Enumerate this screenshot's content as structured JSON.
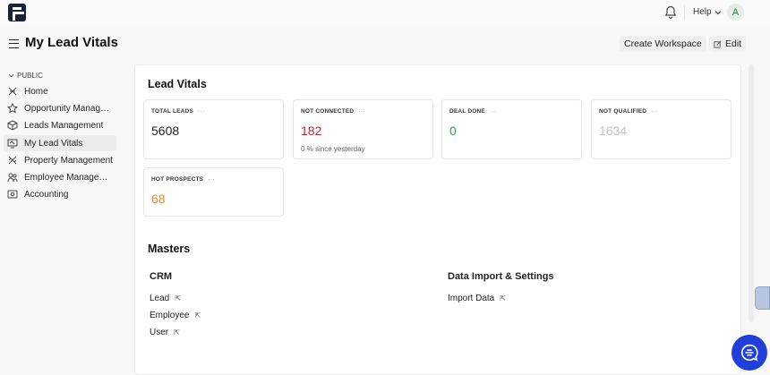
{
  "topbar": {
    "logo_icon": "app-logo",
    "bell_icon": "bell-icon",
    "help_label": "Help",
    "avatar_letter": "A"
  },
  "header": {
    "title": "My Lead Vitals",
    "create_workspace": "Create Workspace",
    "edit": "Edit"
  },
  "sidebar": {
    "section": "PUBLIC",
    "items": [
      {
        "label": "Home",
        "icon": "home-icon"
      },
      {
        "label": "Opportunity Management",
        "icon": "star-icon"
      },
      {
        "label": "Leads Management",
        "icon": "box-icon"
      },
      {
        "label": "My Lead Vitals",
        "icon": "monitor-icon",
        "active": true
      },
      {
        "label": "Property Management",
        "icon": "tools-icon"
      },
      {
        "label": "Employee Management",
        "icon": "users-icon"
      },
      {
        "label": "Accounting",
        "icon": "accounting-icon"
      }
    ]
  },
  "lead_vitals": {
    "title": "Lead Vitals",
    "cards": [
      {
        "label": "TOTAL LEADS",
        "value": "5608",
        "color": "#222222",
        "sub": ""
      },
      {
        "label": "NOT CONNECTED",
        "value": "182",
        "color": "#b82b35",
        "sub": "0 % since yesterday"
      },
      {
        "label": "DEAL DONE",
        "value": "0",
        "color": "#3aa257",
        "sub": ""
      },
      {
        "label": "NOT QUALIFIED",
        "value": "1634",
        "color": "#c3c6cc",
        "sub": ""
      },
      {
        "label": "HOT PROSPECTS",
        "value": "68",
        "color": "#e0883e",
        "sub": ""
      }
    ],
    "dots": "···"
  },
  "masters": {
    "title": "Masters",
    "crm": {
      "title": "CRM",
      "links": [
        "Lead",
        "Employee",
        "User"
      ]
    },
    "data_import": {
      "title": "Data Import & Settings",
      "links": [
        "Import Data"
      ]
    },
    "link_arrow": "⇱"
  }
}
